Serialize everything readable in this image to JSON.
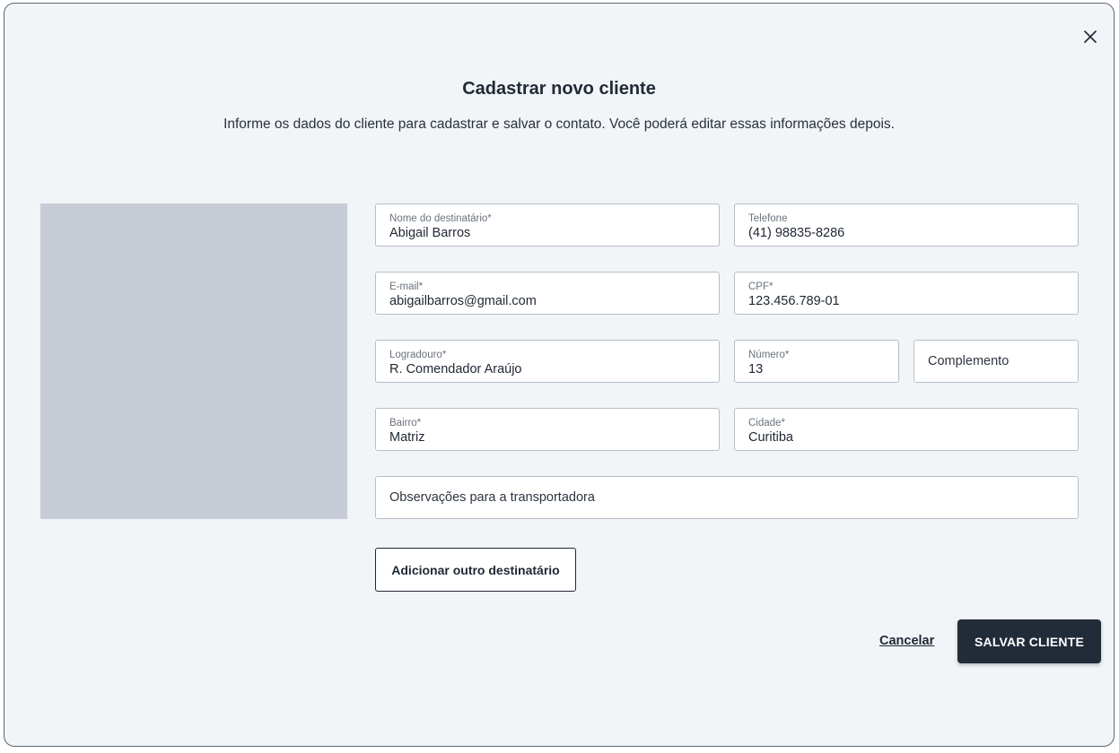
{
  "dialog": {
    "title": "Cadastrar novo cliente",
    "subtitle": "Informe os dados do cliente para cadastrar e salvar o contato. Você poderá editar essas informações depois.",
    "close_icon": "close-icon"
  },
  "form": {
    "nome": {
      "label": "Nome do destinatário*",
      "value": "Abigail Barros"
    },
    "telefone": {
      "label": "Telefone",
      "value": "(41) 98835-8286"
    },
    "email": {
      "label": "E-mail*",
      "value": "abigailbarros@gmail.com"
    },
    "cpf": {
      "label": "CPF*",
      "value": "123.456.789-01"
    },
    "logradouro": {
      "label": "Logradouro*",
      "value": "R. Comendador Araújo"
    },
    "numero": {
      "label": "Número*",
      "value": "13"
    },
    "complemento": {
      "placeholder": "Complemento"
    },
    "bairro": {
      "label": "Bairro*",
      "value": "Matriz"
    },
    "cidade": {
      "label": "Cidade*",
      "value": "Curitiba"
    },
    "observacoes": {
      "placeholder": "Observações para a transportadora"
    }
  },
  "actions": {
    "add_recipient": "Adicionar outro destinatário",
    "cancel": "Cancelar",
    "save": "SALVAR CLIENTE"
  },
  "colors": {
    "dialog_bg": "#f1f5f8",
    "primary_button": "#222b38",
    "image_placeholder": "#c7ccd7"
  }
}
